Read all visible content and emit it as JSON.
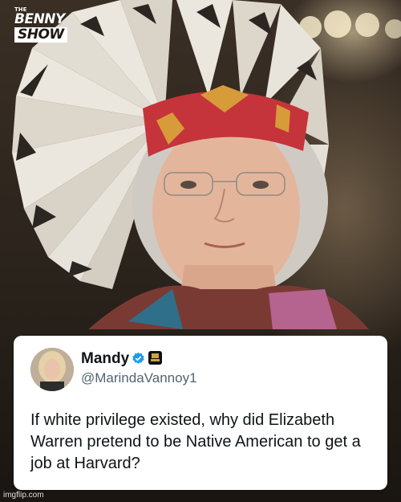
{
  "logo": {
    "small": "THE",
    "line1": "BENNY",
    "line2": "SHOW"
  },
  "tweet": {
    "display_name": "Mandy",
    "handle": "@MarindaVannoy1",
    "text": "If white privilege existed, why did Elizabeth Warren pretend to be Native American to get a job at Harvard?",
    "verified": true,
    "verified_color": "#1d9bf0"
  },
  "watermark": "imgflip.com",
  "icons": [
    "verified-badge-icon",
    "affiliate-badge-icon"
  ]
}
